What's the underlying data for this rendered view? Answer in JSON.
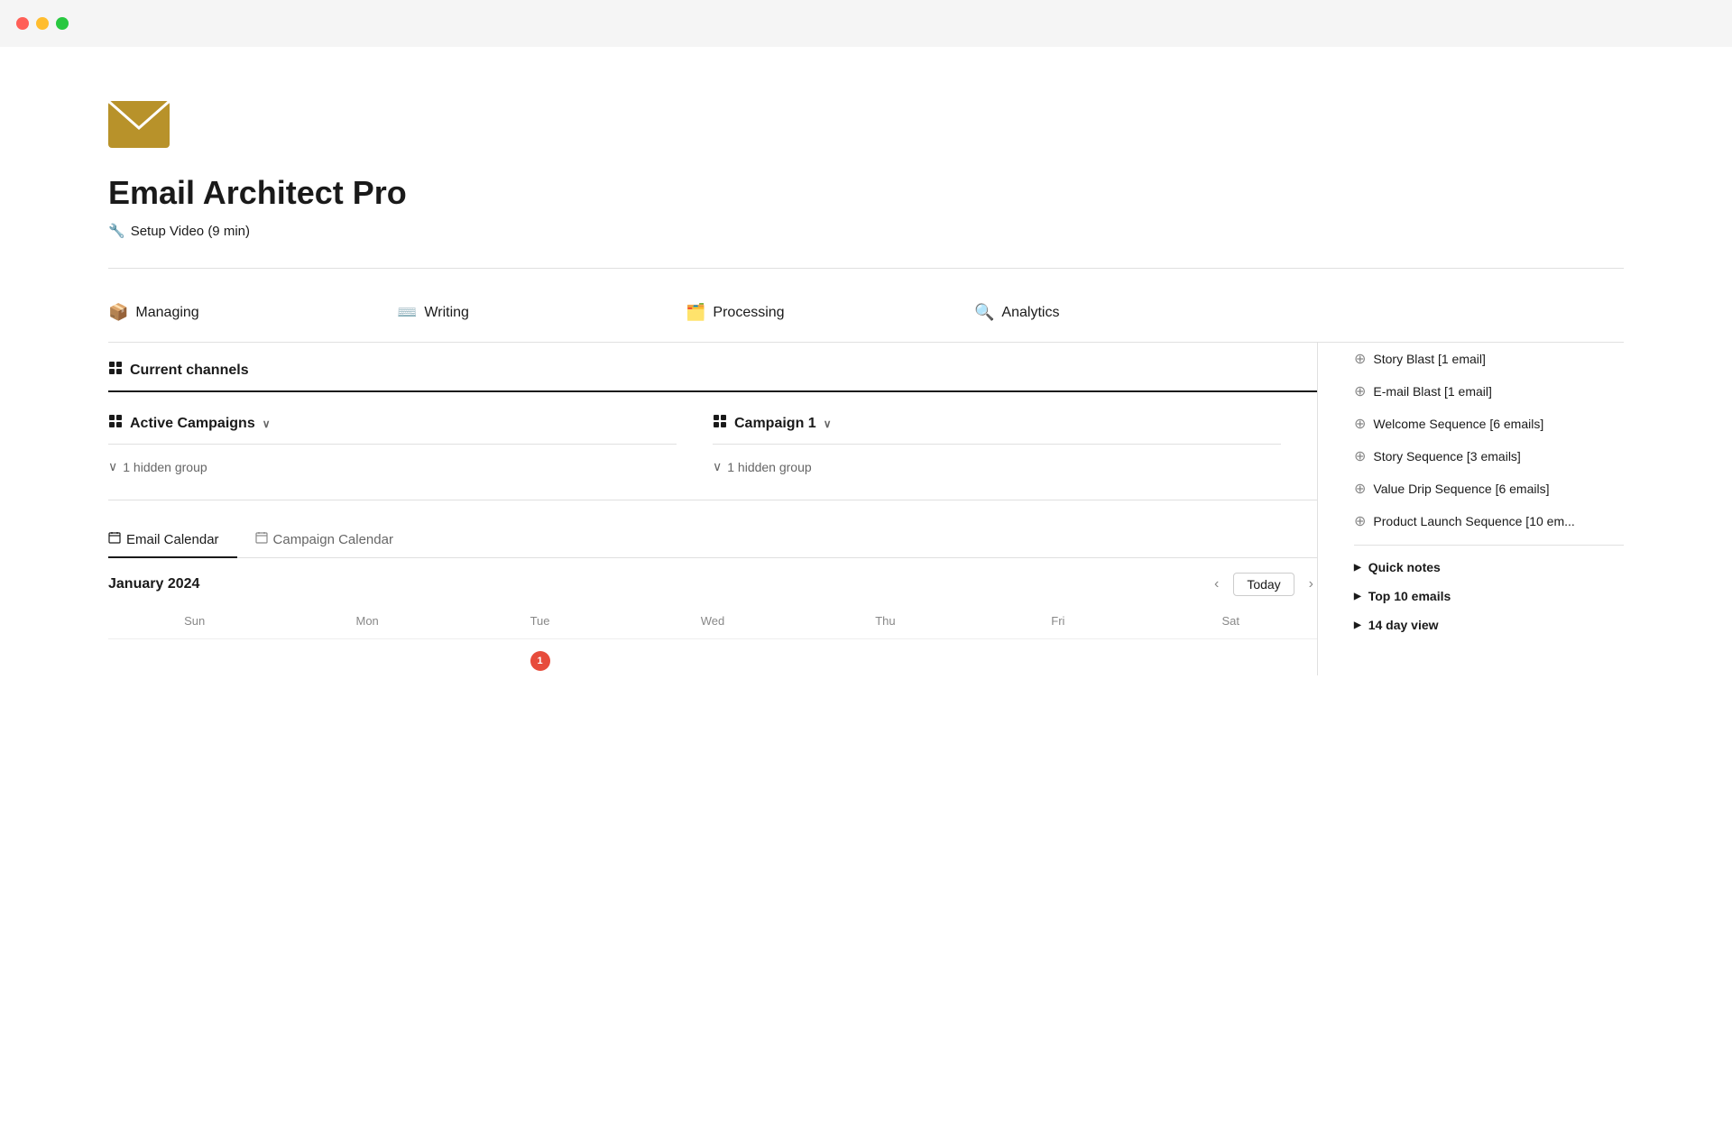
{
  "window": {
    "controls": {
      "close_label": "",
      "minimize_label": "",
      "maximize_label": ""
    }
  },
  "app": {
    "title": "Email Architect Pro",
    "setup_link": "Setup Video (9 min)"
  },
  "nav": {
    "items": [
      {
        "id": "managing",
        "icon": "📦",
        "label": "Managing"
      },
      {
        "id": "writing",
        "icon": "⌨️",
        "label": "Writing"
      },
      {
        "id": "processing",
        "icon": "🗂️",
        "label": "Processing"
      },
      {
        "id": "analytics",
        "icon": "🔍",
        "label": "Analytics"
      }
    ]
  },
  "current_channels": {
    "section_label": "Current channels"
  },
  "campaigns": {
    "active": {
      "label": "Active Campaigns",
      "hidden_group": "1 hidden group"
    },
    "campaign1": {
      "label": "Campaign 1",
      "hidden_group": "1 hidden group"
    }
  },
  "sidebar": {
    "sequences": [
      {
        "label": "Story Blast [1 email]"
      },
      {
        "label": "E-mail Blast [1 email]"
      },
      {
        "label": "Welcome Sequence [6 emails]"
      },
      {
        "label": "Story Sequence [3 emails]"
      },
      {
        "label": "Value Drip Sequence [6 emails]"
      },
      {
        "label": "Product Launch Sequence [10 em..."
      }
    ],
    "collapsibles": [
      {
        "id": "quick-notes",
        "label": "Quick notes"
      },
      {
        "id": "top-10-emails",
        "label": "Top 10 emails"
      },
      {
        "id": "14-day-view",
        "label": "14 day view"
      }
    ]
  },
  "calendar": {
    "tabs": [
      {
        "id": "email-calendar",
        "label": "Email Calendar",
        "active": true
      },
      {
        "id": "campaign-calendar",
        "label": "Campaign Calendar",
        "active": false
      }
    ],
    "month_label": "January 2024",
    "today_btn": "Today",
    "day_headers": [
      "Sun",
      "Mon",
      "Tue",
      "Wed",
      "Thu",
      "Fri",
      "Sat"
    ]
  }
}
